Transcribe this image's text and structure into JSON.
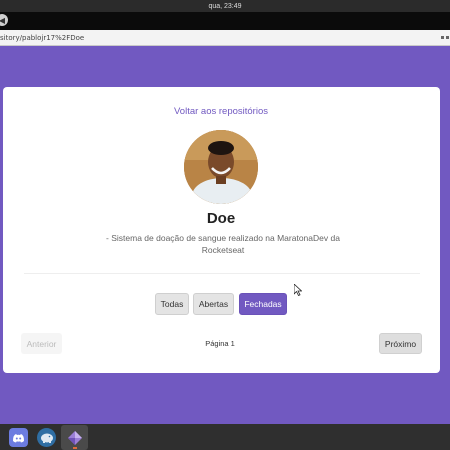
{
  "system": {
    "clock": "qua, 23:49"
  },
  "browser": {
    "url": "sitory/pablojr17%2FDoe"
  },
  "page": {
    "back_link": "Voltar aos repositórios",
    "repo_name": "Doe",
    "repo_description": "- Sistema de doação de sangue realizado na MaratonaDev da Rocketseat",
    "filters": [
      {
        "label": "Todas",
        "active": false
      },
      {
        "label": "Abertas",
        "active": false
      },
      {
        "label": "Fechadas",
        "active": true
      }
    ],
    "pagination": {
      "prev_label": "Anterior",
      "page_label": "Página 1",
      "next_label": "Próximo"
    }
  },
  "dock": {
    "items": [
      {
        "icon": "discord-icon"
      },
      {
        "icon": "elephant-icon"
      },
      {
        "icon": "crystal-icon",
        "active": true
      }
    ]
  },
  "colors": {
    "accent": "#7159c1"
  }
}
